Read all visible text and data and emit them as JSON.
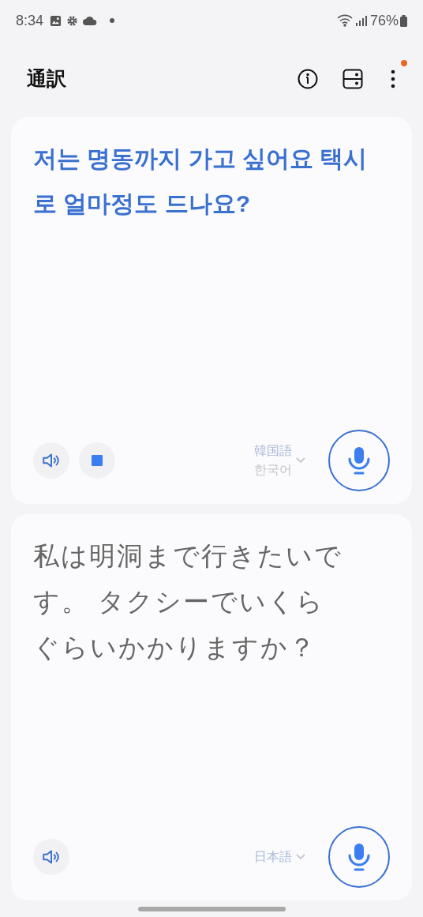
{
  "status_bar": {
    "time": "8:34",
    "battery": "76%"
  },
  "header": {
    "title": "通訳",
    "menu_badge": true
  },
  "panels": [
    {
      "text": "저는 명동까지 가고 싶어요 택시로 얼마정도 드나요?",
      "active": true,
      "playing": true,
      "languages": [
        "韓国語",
        "한국어"
      ]
    },
    {
      "text": "私は明洞まで行きたいです。 タクシーでいくらぐらいかかりますか？",
      "active": false,
      "playing": false,
      "languages": [
        "日本語"
      ]
    }
  ]
}
